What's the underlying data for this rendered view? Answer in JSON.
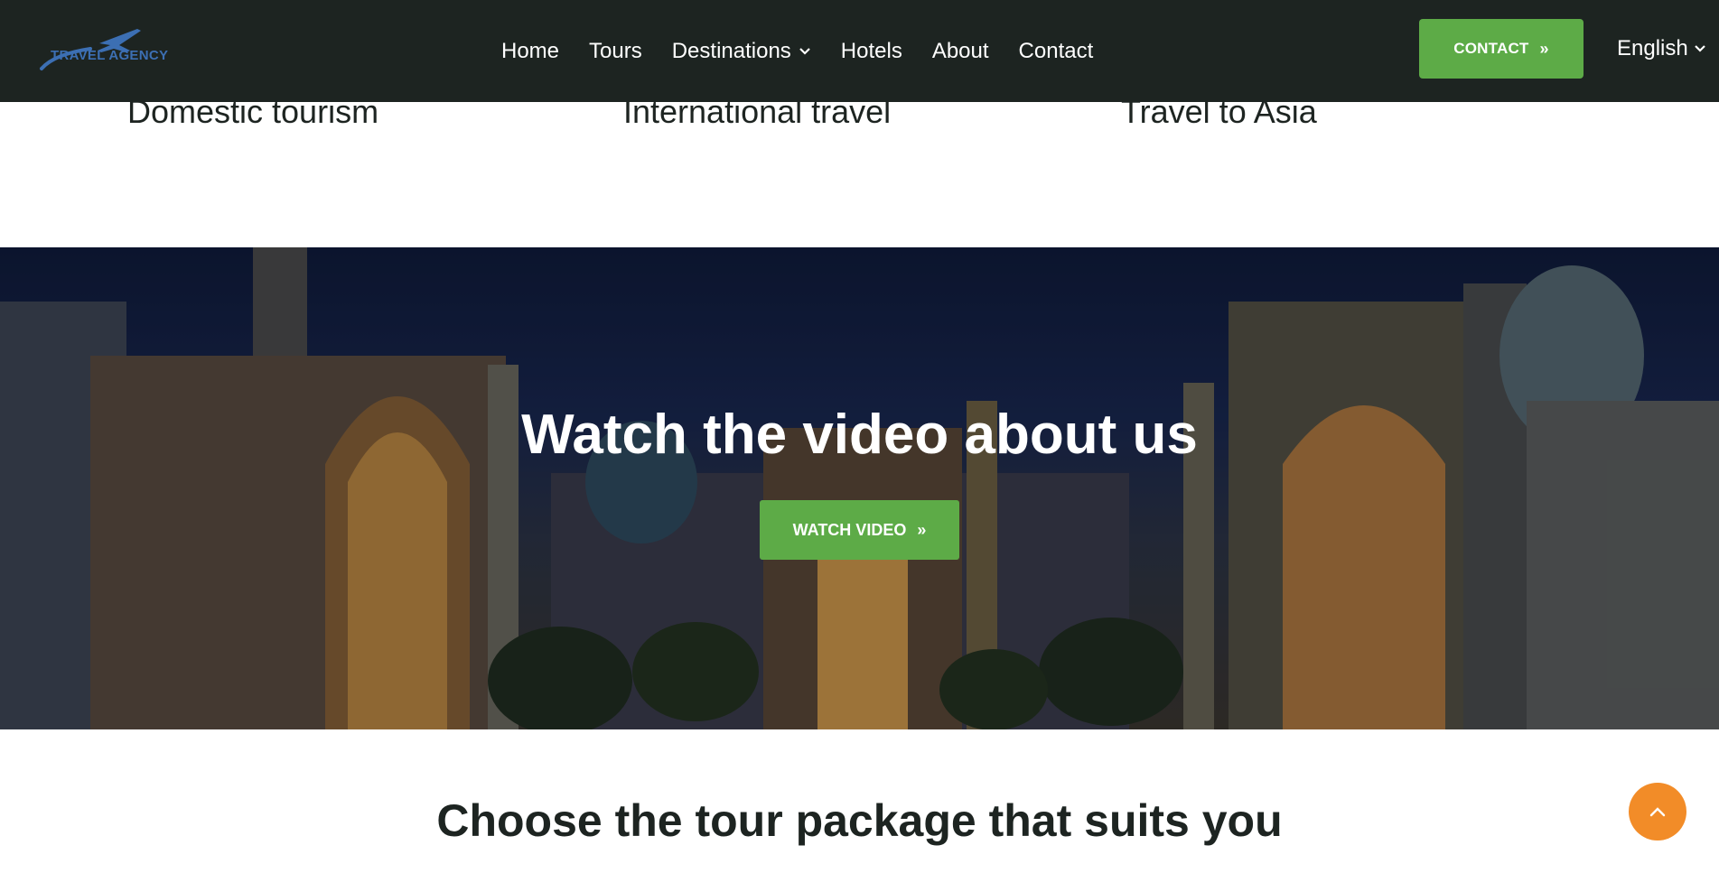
{
  "header": {
    "logo_text": "TRAVEL AGENCY",
    "nav": [
      {
        "label": "Home"
      },
      {
        "label": "Tours"
      },
      {
        "label": "Destinations"
      },
      {
        "label": "Hotels"
      },
      {
        "label": "About"
      },
      {
        "label": "Contact"
      }
    ],
    "cta_label": "CONTACT",
    "language": "English"
  },
  "categories": [
    {
      "label": "Domestic tourism"
    },
    {
      "label": "International travel"
    },
    {
      "label": "Travel to Asia"
    }
  ],
  "video_banner": {
    "title": "Watch the video about us",
    "button_label": "WATCH VIDEO"
  },
  "packages": {
    "title": "Choose the tour package that suits you"
  },
  "colors": {
    "header_bg": "#1d2421",
    "accent_green": "#5dab47",
    "accent_orange": "#f28c28",
    "logo_blue": "#3c6fb3"
  },
  "icons": {
    "destinations_dropdown": "chevron-down-icon",
    "language_dropdown": "chevron-down-icon",
    "cta_arrow": "double-chevron-right-icon",
    "watch_arrow": "double-chevron-right-icon",
    "to_top": "chevron-up-icon",
    "logo": "airplane-icon"
  }
}
